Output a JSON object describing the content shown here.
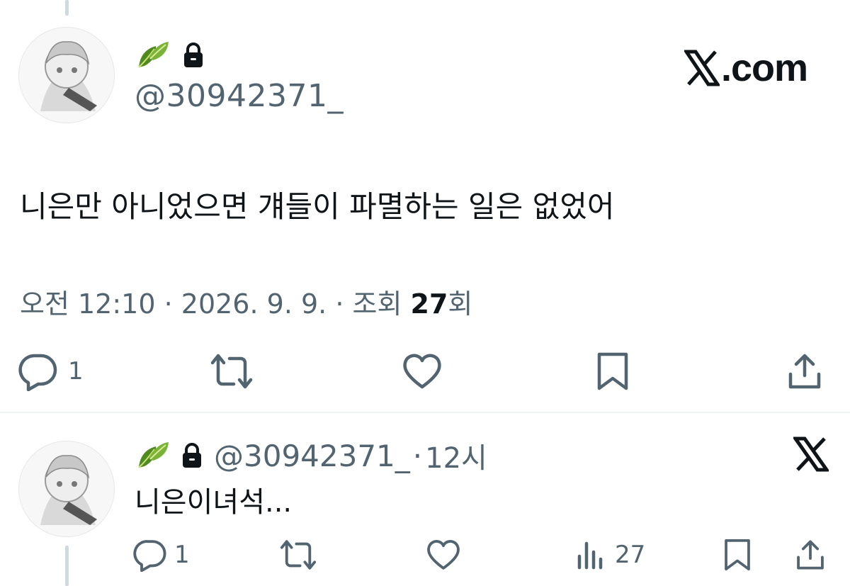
{
  "main_tweet": {
    "display_name_emoji": "🍃",
    "handle": "@30942371_",
    "brand": "X.com",
    "text": "니은만 아니었으면 걔들이 파멸하는 일은 없었어",
    "meta": {
      "time": "오전 12:10",
      "date": "2026. 9. 9.",
      "views_label": "조회",
      "views_count": "27",
      "views_suffix": "회"
    },
    "actions": {
      "reply_count": "1",
      "retweet_count": "",
      "like_count": "",
      "bookmark_count": ""
    }
  },
  "reply_tweet": {
    "display_name_emoji": "🍃",
    "handle": "@30942371_",
    "time_ago": "12시",
    "text": "니은이녀석...",
    "actions": {
      "reply_count": "1",
      "retweet_count": "",
      "like_count": "",
      "views_count": "27"
    }
  },
  "colors": {
    "text_primary": "#0f1419",
    "text_secondary": "#536471",
    "divider": "#eff3f4",
    "thread_line": "#cfd9de"
  }
}
